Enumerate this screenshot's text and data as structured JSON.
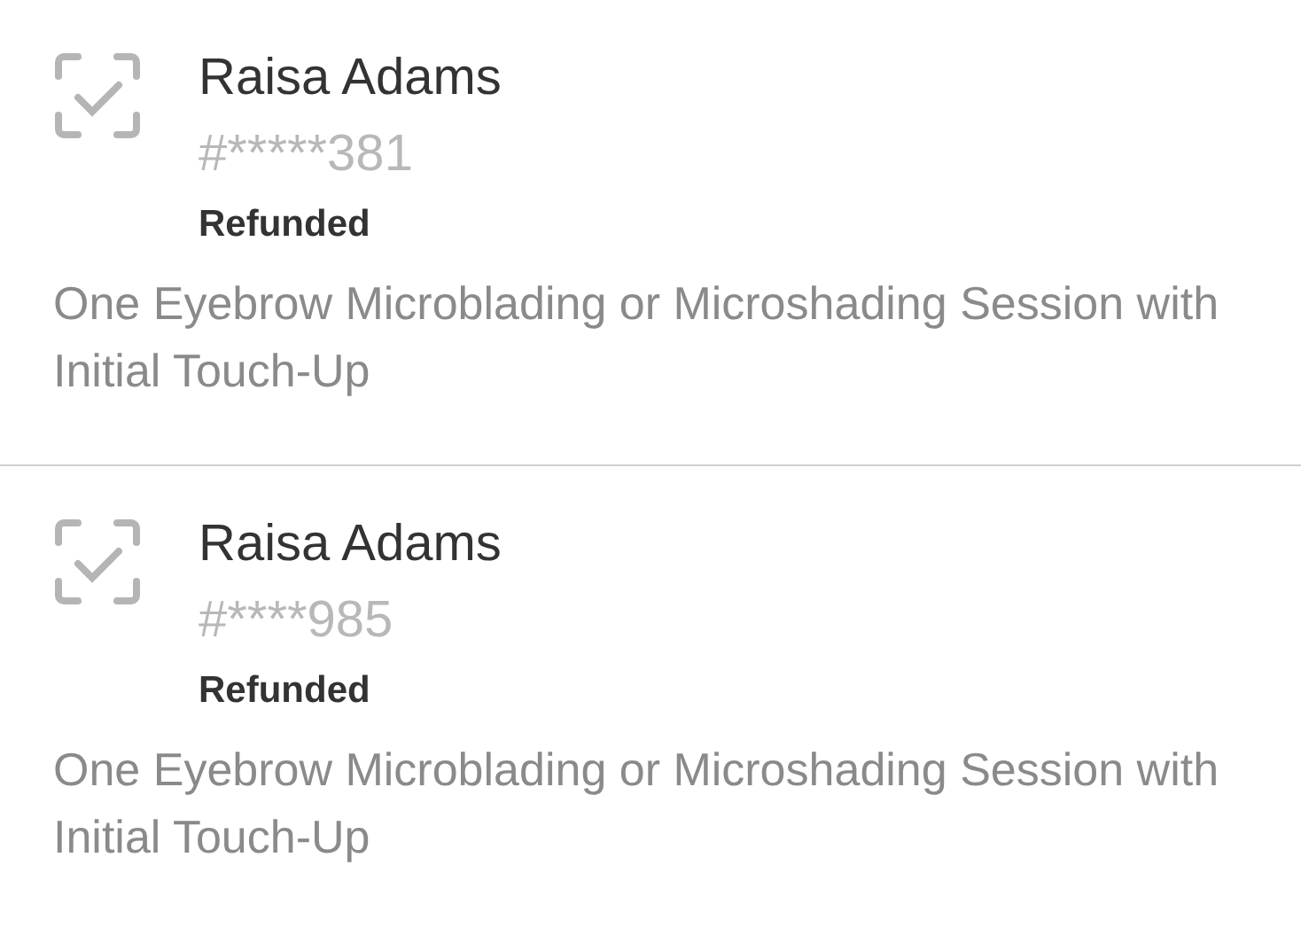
{
  "orders": [
    {
      "customer": "Raisa Adams",
      "code": "#*****381",
      "status": "Refunded",
      "description": "One Eyebrow Microblading or Microshading Session with Initial Touch-Up"
    },
    {
      "customer": "Raisa Adams",
      "code": "#****985",
      "status": "Refunded",
      "description": "One Eyebrow Microblading or Microshading Session with Initial Touch-Up"
    }
  ]
}
